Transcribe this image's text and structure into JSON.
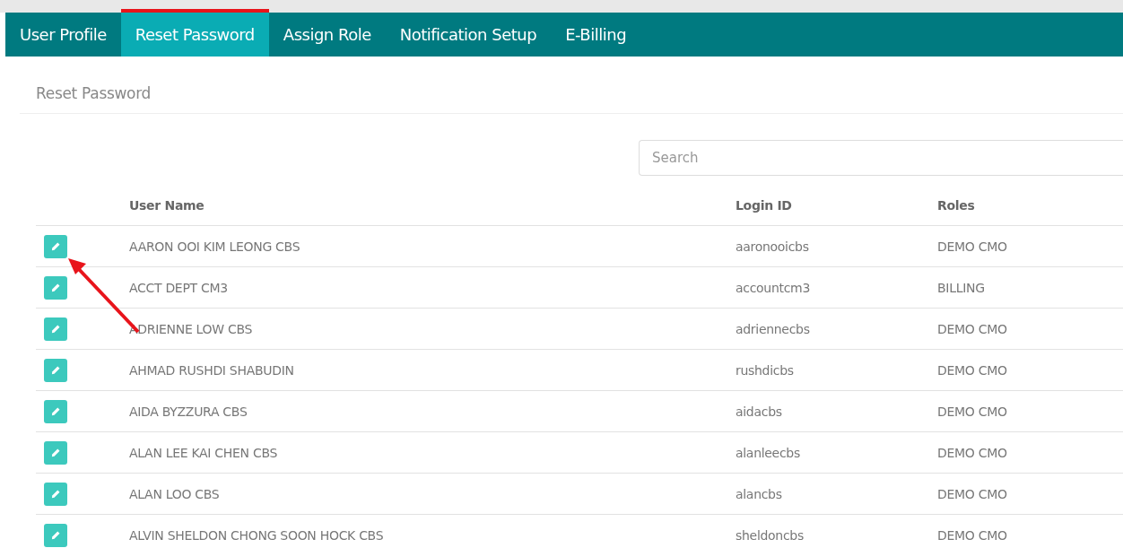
{
  "tabs": [
    {
      "label": "User Profile",
      "selected": false
    },
    {
      "label": "Reset Password",
      "selected": true
    },
    {
      "label": "Assign Role",
      "selected": false
    },
    {
      "label": "Notification Setup",
      "selected": false
    },
    {
      "label": "E-Billing",
      "selected": false
    }
  ],
  "panel_title": "Reset Password",
  "search": {
    "placeholder": "Search"
  },
  "table": {
    "columns": [
      "User Name",
      "Login ID",
      "Roles"
    ],
    "rows": [
      {
        "user_name": "AARON OOI KIM LEONG CBS",
        "login_id": "aaronooicbs",
        "roles": "DEMO CMO"
      },
      {
        "user_name": "ACCT DEPT CM3",
        "login_id": "accountcm3",
        "roles": "BILLING"
      },
      {
        "user_name": "ADRIENNE LOW CBS",
        "login_id": "adriennecbs",
        "roles": "DEMO CMO"
      },
      {
        "user_name": "AHMAD RUSHDI SHABUDIN",
        "login_id": "rushdicbs",
        "roles": "DEMO CMO"
      },
      {
        "user_name": "AIDA BYZZURA CBS",
        "login_id": "aidacbs",
        "roles": "DEMO CMO"
      },
      {
        "user_name": "ALAN LEE KAI CHEN CBS",
        "login_id": "alanleecbs",
        "roles": "DEMO CMO"
      },
      {
        "user_name": "ALAN LOO CBS",
        "login_id": "alancbs",
        "roles": "DEMO CMO"
      },
      {
        "user_name": "ALVIN SHELDON CHONG SOON HOCK CBS",
        "login_id": "sheldoncbs",
        "roles": "DEMO CMO"
      }
    ]
  }
}
